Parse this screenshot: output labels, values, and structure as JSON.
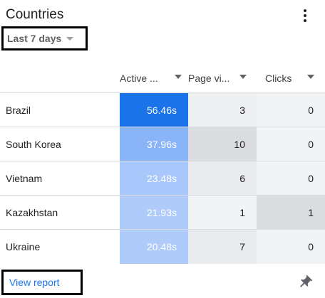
{
  "card": {
    "title": "Countries",
    "date_range": "Last 7 days",
    "view_report": "View report"
  },
  "columns": [
    "Active ...",
    "Page vi...",
    "Clicks"
  ],
  "rows": [
    {
      "country": "Brazil",
      "active": "56.46s",
      "pageviews": "3",
      "clicks": "0"
    },
    {
      "country": "South Korea",
      "active": "37.96s",
      "pageviews": "10",
      "clicks": "0"
    },
    {
      "country": "Vietnam",
      "active": "23.48s",
      "pageviews": "6",
      "clicks": "0"
    },
    {
      "country": "Kazakhstan",
      "active": "21.93s",
      "pageviews": "1",
      "clicks": "1"
    },
    {
      "country": "Ukraine",
      "active": "20.48s",
      "pageviews": "7",
      "clicks": "0"
    }
  ],
  "heat_colors": {
    "active": [
      "#1a73e8",
      "#8ab4f8",
      "#a8c7fa",
      "#aecbfa",
      "#aecbfa"
    ],
    "pageviews": [
      "#eeeff1",
      "#dadce0",
      "#e8eaed",
      "#f1f3f4",
      "#e8eaed"
    ],
    "clicks": [
      "#f1f3f4",
      "#f1f3f4",
      "#f1f3f4",
      "#dadce0",
      "#f1f3f4"
    ]
  },
  "icons": {
    "menu": "more-vert-icon",
    "pin": "pin-icon",
    "dropdown": "caret-down-icon"
  }
}
